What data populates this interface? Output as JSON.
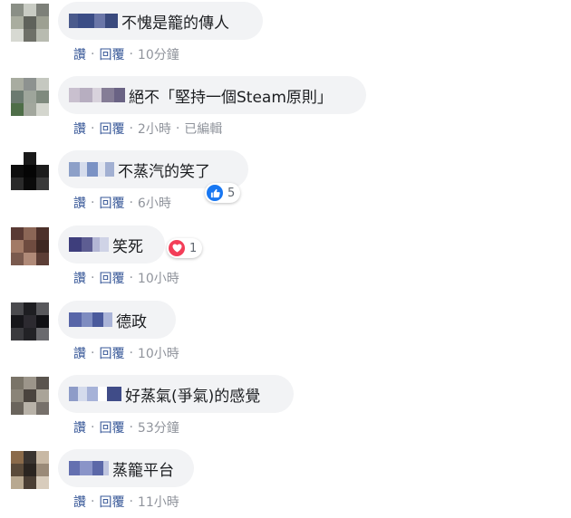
{
  "labels": {
    "like": "讚",
    "reply": "回覆",
    "dot": "·"
  },
  "comments": [
    {
      "text": "不愧是籠的傳人",
      "time": "10分鐘",
      "edited": ""
    },
    {
      "text": "絕不「堅持一個Steam原則」",
      "time": "2小時",
      "edited": "已編輯"
    },
    {
      "text": "不蒸汽的笑了",
      "time": "6小時",
      "edited": "",
      "reaction": {
        "icon": "like-reaction-icon",
        "count": "5",
        "color": "#1877f2"
      }
    },
    {
      "text": "笑死",
      "time": "10小時",
      "edited": "",
      "reaction": {
        "icon": "love-reaction-icon",
        "count": "1",
        "color": "#f33e58"
      }
    },
    {
      "text": "德政",
      "time": "10小時",
      "edited": ""
    },
    {
      "text": "好蒸氣(爭氣)的感覺",
      "time": "53分鐘",
      "edited": ""
    },
    {
      "text": "蒸籠平台",
      "time": "11小時",
      "edited": ""
    }
  ],
  "colors": {
    "link": "#385898",
    "meta": "#90949c",
    "bubble": "#f2f3f5"
  }
}
